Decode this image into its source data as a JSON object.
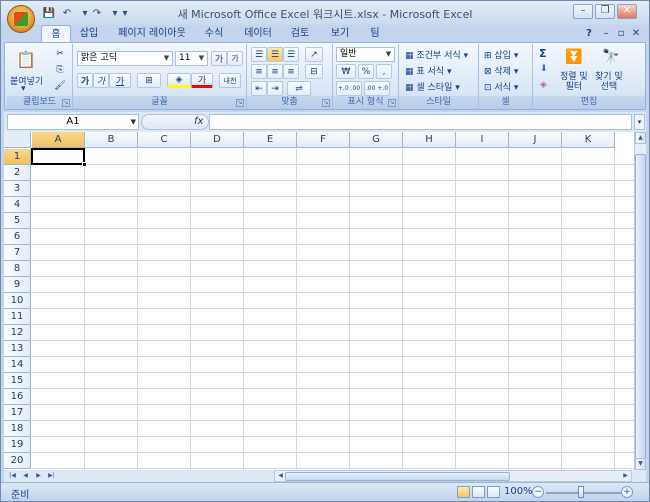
{
  "window": {
    "title": "새 Microsoft Office Excel 워크시트.xlsx - Microsoft Excel",
    "minimize": "–",
    "restore": "❐",
    "close": "✕",
    "qat": {
      "save": "💾",
      "undo": "↶",
      "redo": "↷",
      "more": "▾"
    }
  },
  "tabs": [
    "홈",
    "삽입",
    "페이지 레이아웃",
    "수식",
    "데이터",
    "검토",
    "보기",
    "팀"
  ],
  "ribbon_right": {
    "help": "?",
    "min": "–",
    "restore": "▫",
    "close": "✕"
  },
  "groups": {
    "clipboard": {
      "label": "클립보드",
      "paste": "붙여넣기",
      "paste_arrow": "▾",
      "cut": "✂",
      "copy": "⎘",
      "format_painter": "🖌"
    },
    "font": {
      "label": "글꼴",
      "font_name": "맑은 고딕",
      "font_size": "11",
      "grow": "가",
      "shrink": "가",
      "bold": "가",
      "italic": "가",
      "underline": "가",
      "borders": "⊞",
      "fill": "◈",
      "color": "가",
      "phonetic": "내천"
    },
    "alignment": {
      "label": "맞춤",
      "wrap": "⇌",
      "merge": "⊟"
    },
    "number": {
      "label": "표시 형식",
      "format": "일반",
      "currency": "₩",
      "percent": "%",
      "comma": ",",
      "inc_dec": "+.0 .00",
      "dec_dec": ".00 +.0"
    },
    "styles": {
      "label": "스타일",
      "conditional": "조건부 서식",
      "table": "표 서식",
      "cell": "셀 스타일"
    },
    "cells": {
      "label": "셀",
      "insert": "삽입",
      "delete": "삭제",
      "format": "서식"
    },
    "editing": {
      "label": "편집",
      "sum": "Σ",
      "fill": "⬇",
      "clear": "◈",
      "sort": "정렬 및\n필터",
      "find": "찾기 및\n선택"
    }
  },
  "formula_bar": {
    "name_box": "A1",
    "fx": "fx",
    "formula": "",
    "expand": "▾"
  },
  "columns": [
    "A",
    "B",
    "C",
    "D",
    "E",
    "F",
    "G",
    "H",
    "I",
    "J",
    "K"
  ],
  "rows": [
    "1",
    "2",
    "3",
    "4",
    "5",
    "6",
    "7",
    "8",
    "9",
    "10",
    "11",
    "12",
    "13",
    "14",
    "15",
    "16",
    "17",
    "18",
    "19",
    "20"
  ],
  "selection": {
    "column": "A",
    "row": "1"
  },
  "status": {
    "ready": "준비",
    "zoom": "100%",
    "zoom_minus": "−",
    "zoom_plus": "+"
  },
  "scroll": {
    "up": "▲",
    "down": "▼",
    "left": "◀",
    "right": "▶",
    "first": "|◀",
    "last": "▶|"
  }
}
